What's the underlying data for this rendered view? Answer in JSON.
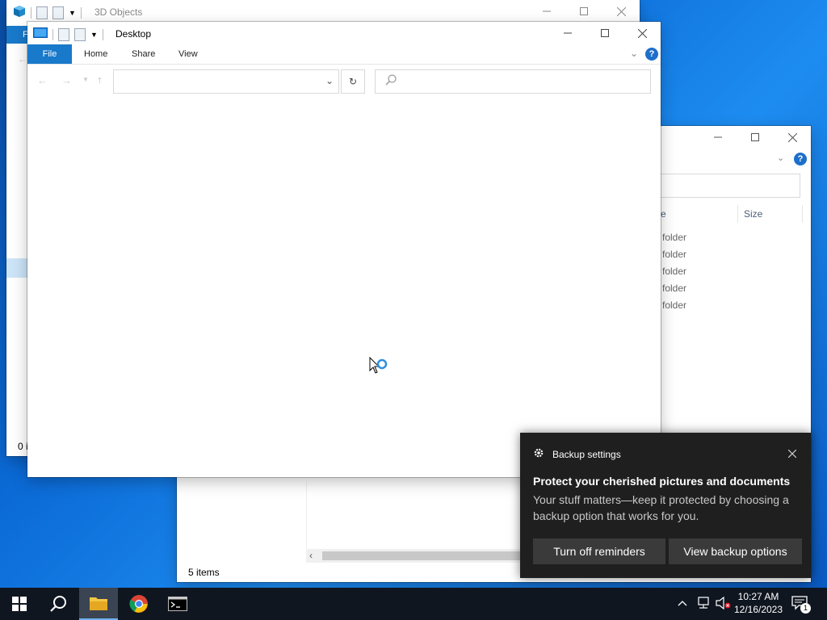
{
  "bg_window_3d": {
    "title": "3D Objects",
    "file_tab_partial": "F",
    "status_partial": "0 i"
  },
  "bg_window_right": {
    "column_header_name_partial": "e",
    "column_header_size": "Size",
    "rows": [
      "folder",
      "folder",
      "folder",
      "folder",
      "folder"
    ],
    "status": "5 items"
  },
  "main_window": {
    "title": "Desktop",
    "tabs": {
      "file": "File",
      "home": "Home",
      "share": "Share",
      "view": "View"
    },
    "address_value": "",
    "search_placeholder": ""
  },
  "toast": {
    "app_name": "Backup settings",
    "heading": "Protect your cherished pictures and documents",
    "body": "Your stuff matters—keep it protected by choosing a backup option that works for you.",
    "button_left": "Turn off reminders",
    "button_right": "View backup options"
  },
  "taskbar": {
    "time": "10:27 AM",
    "date": "12/16/2023",
    "notification_count": "1"
  },
  "colors": {
    "accent": "#1979ca",
    "taskbar": "#101620",
    "toast_bg": "#1f1f1f",
    "toast_button": "#3a3a3a"
  }
}
